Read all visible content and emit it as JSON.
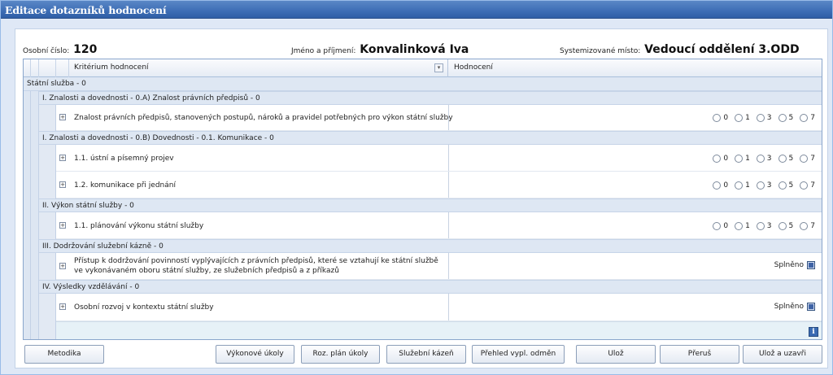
{
  "window": {
    "title": "Editace dotazníků hodnocení"
  },
  "info": {
    "osobni_cislo_label": "Osobní číslo:",
    "osobni_cislo_value": "120",
    "jmeno_label": "Jméno a příjmení:",
    "jmeno_value": "Konvalinková Iva",
    "misto_label": "Systemizované místo:",
    "misto_value": "Vedoucí oddělení 3.ODD"
  },
  "grid": {
    "col_kriterium": "Kritérium hodnocení",
    "col_hodnoceni": "Hodnocení",
    "root_group": "Státní služba - 0",
    "groups": [
      "I. Znalosti a dovednosti - 0.A) Znalost právních předpisů - 0",
      "I. Znalosti a dovednosti - 0.B) Dovednosti - 0.1. Komunikace - 0",
      "II. Výkon státní služby - 0",
      "III. Dodržování služební kázně - 0",
      "IV. Výsledky vzdělávání - 0"
    ],
    "rows": [
      "Znalost právních předpisů, stanovených postupů, nároků a pravidel potřebných pro výkon státní služby",
      "1.1. ústní a písemný projev",
      "1.2. komunikace při jednání",
      "1.1. plánování výkonu státní služby",
      "Přístup k dodržování povinností vyplývajících z právních předpisů, které se vztahují ke státní službě ve vykonávaném oboru státní služby, ze služebních předpisů a z příkazů",
      "Osobní rozvoj v kontextu státní služby"
    ],
    "rating_options": [
      "0",
      "1",
      "3",
      "5",
      "7"
    ],
    "splneno_label": "Splněno"
  },
  "buttons": {
    "metodika": "Metodika",
    "vykonove_ukoly": "Výkonové úkoly",
    "roz_plan_ukoly": "Roz. plán úkoly",
    "sluzebni_kazen": "Služební kázeň",
    "prehled_odmen": "Přehled vypl. odměn",
    "uloz": "Ulož",
    "prerus": "Přeruš",
    "uloz_uzavri": "Ulož a uzavři"
  }
}
